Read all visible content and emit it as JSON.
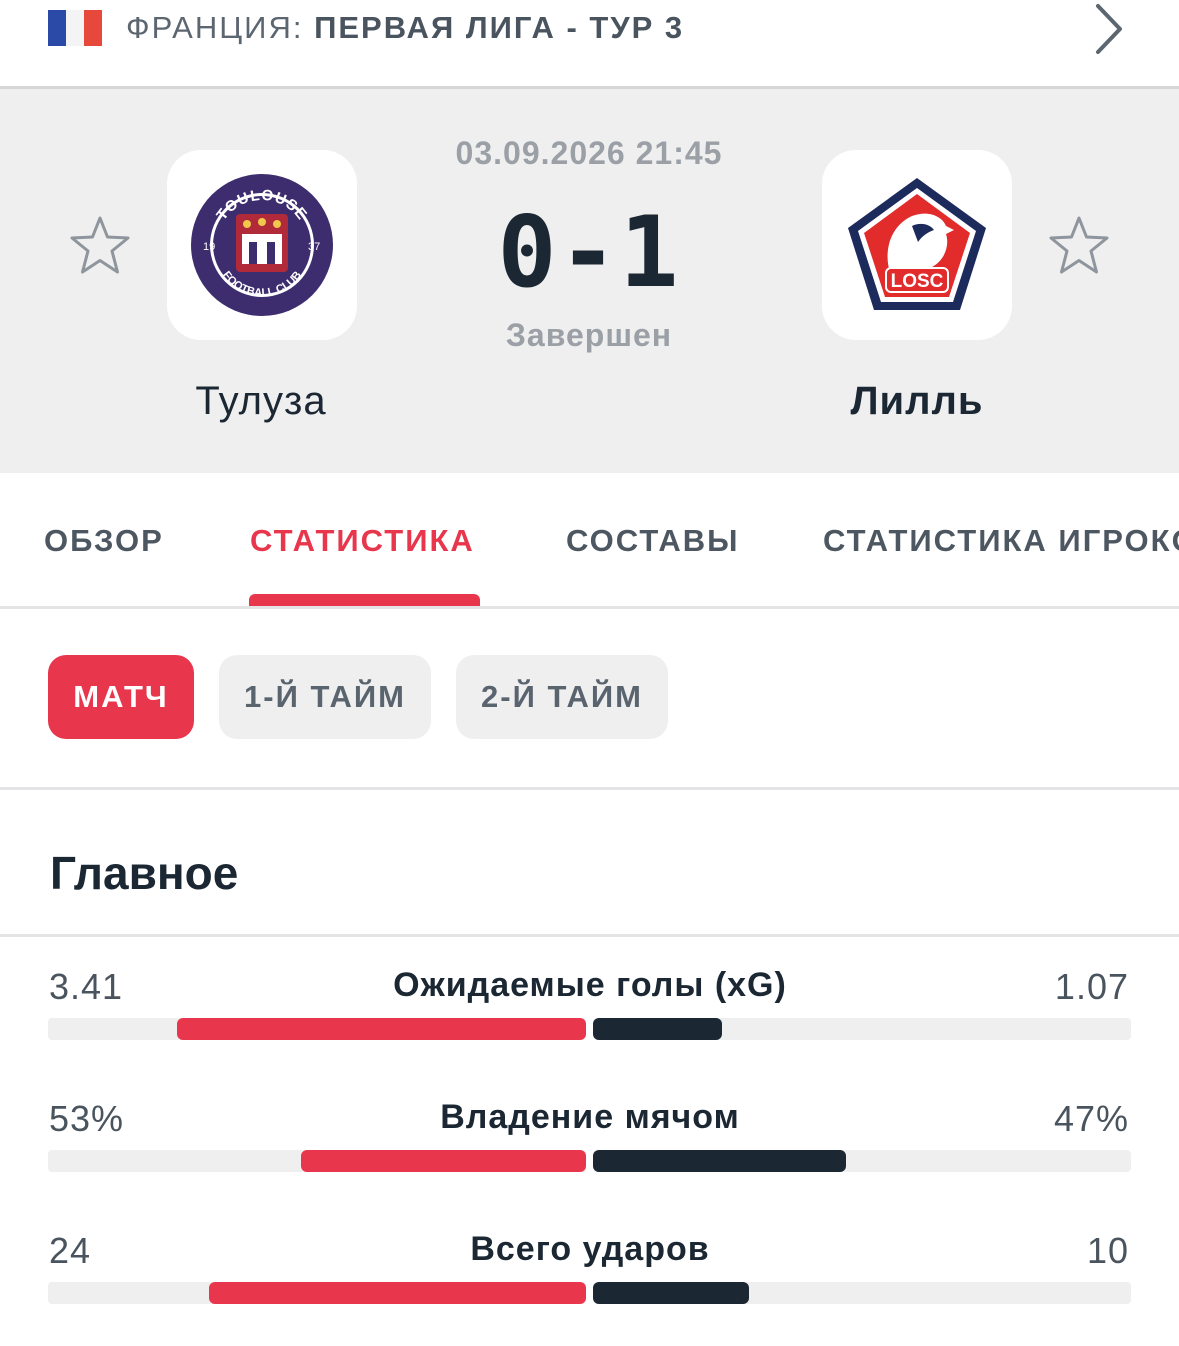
{
  "league": {
    "country": "ФРАНЦИЯ:",
    "competition": "ПЕРВАЯ ЛИГА - ТУР 3",
    "flag_colors": [
      "#2b4aa8",
      "#f4f4f4",
      "#e6483c"
    ]
  },
  "match": {
    "kickoff": "03.09.2026 21:45",
    "score": "0-1",
    "status": "Завершен",
    "home": {
      "name": "Тулуза",
      "crest": {
        "top_text": "TOULOUSE",
        "bottom_text": "FOOTBALL CLUB",
        "year_left": "19",
        "year_right": "37",
        "color": "#3d2d6e"
      }
    },
    "away": {
      "name": "Лилль",
      "crest": {
        "text": "LOSC",
        "color_red": "#e22b2b",
        "color_navy": "#1d2a5c"
      }
    }
  },
  "tabs": [
    {
      "label": "ОБЗОР",
      "active": false
    },
    {
      "label": "СТАТИСТИКА",
      "active": true
    },
    {
      "label": "СОСТАВЫ",
      "active": false
    },
    {
      "label": "СТАТИСТИКА ИГРОКОВ",
      "active": false
    }
  ],
  "periods": [
    {
      "label": "МАТЧ",
      "active": true
    },
    {
      "label": "1-Й ТАЙМ",
      "active": false
    },
    {
      "label": "2-Й ТАЙМ",
      "active": false
    }
  ],
  "section_title": "Главное",
  "stats": [
    {
      "label": "Ожидаемые голы (xG)",
      "home": "3.41",
      "away": "1.07",
      "home_share": 0.76,
      "away_share": 0.24
    },
    {
      "label": "Владение мячом",
      "home": "53%",
      "away": "47%",
      "home_share": 0.53,
      "away_share": 0.47
    },
    {
      "label": "Всего ударов",
      "home": "24",
      "away": "10",
      "home_share": 0.7,
      "away_share": 0.29
    }
  ],
  "colors": {
    "accent": "#e8374d",
    "away_bar": "#1b2732",
    "header_bg": "#efeff0"
  }
}
